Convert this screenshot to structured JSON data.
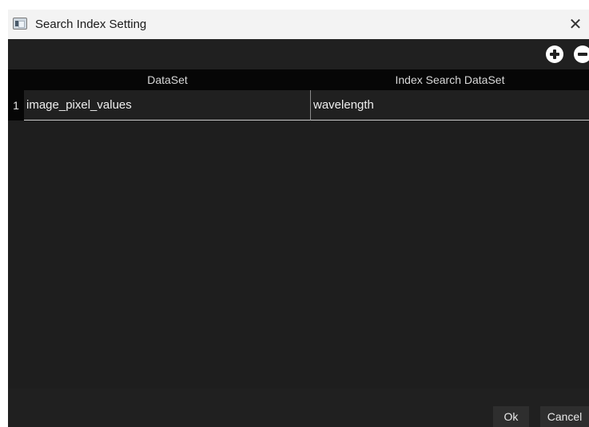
{
  "window": {
    "title": "Search Index Setting",
    "close_label": "✕"
  },
  "toolbar": {
    "add_icon": "plus-circle-icon",
    "remove_icon": "minus-circle-icon"
  },
  "table": {
    "columns": [
      "DataSet",
      "Index Search DataSet"
    ],
    "rows": [
      {
        "number": "1",
        "dataset": "image_pixel_values",
        "index_search_dataset": "wavelength"
      }
    ]
  },
  "footer": {
    "ok_label": "Ok",
    "cancel_label": "Cancel"
  },
  "colors": {
    "background": "#202020",
    "header": "#060606",
    "titlebar": "#f3f3f3"
  }
}
